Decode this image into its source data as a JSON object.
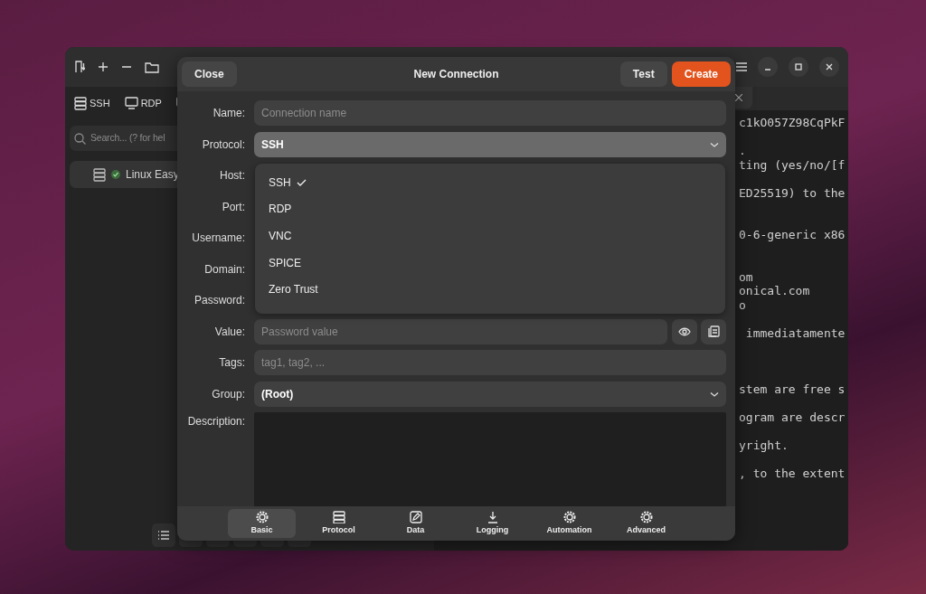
{
  "sidebar": {
    "protocol_filters": [
      {
        "label": "SSH"
      },
      {
        "label": "RDP"
      }
    ],
    "search": {
      "placeholder": "Search... (? for hel"
    },
    "items": [
      {
        "label": "Linux Easy",
        "connected": true,
        "selected": true
      }
    ]
  },
  "terminal": {
    "lines": [
      {
        "kind": "text",
        "text": "c1kO057Z98CqPkF"
      },
      {
        "kind": "blank"
      },
      {
        "kind": "text",
        "text": "."
      },
      {
        "kind": "text",
        "text": "ting (yes/no/[f"
      },
      {
        "kind": "blank"
      },
      {
        "kind": "text",
        "text": "ED25519) to the"
      },
      {
        "kind": "blank"
      },
      {
        "kind": "blank"
      },
      {
        "kind": "text",
        "text": "0-6-generic x86"
      },
      {
        "kind": "blank"
      },
      {
        "kind": "blank"
      },
      {
        "kind": "text",
        "text": "om"
      },
      {
        "kind": "text",
        "text": "onical.com"
      },
      {
        "kind": "text",
        "text": "o"
      },
      {
        "kind": "blank"
      },
      {
        "kind": "text",
        "text": " immediatamente"
      },
      {
        "kind": "blank"
      },
      {
        "kind": "blank"
      },
      {
        "kind": "blank"
      },
      {
        "kind": "text",
        "text": "stem are free s"
      },
      {
        "kind": "blank"
      },
      {
        "kind": "text",
        "text": "ogram are descr"
      },
      {
        "kind": "blank"
      },
      {
        "kind": "text",
        "text": "yright."
      },
      {
        "kind": "blank"
      },
      {
        "kind": "text",
        "text": ", to the extent"
      }
    ]
  },
  "dialog": {
    "title": "New Connection",
    "buttons": [
      {
        "label": "Close",
        "kind": "plain"
      },
      {
        "label": "Test",
        "kind": "plain"
      },
      {
        "label": "Create",
        "kind": "primary"
      }
    ],
    "fields": [
      {
        "label": "Name:",
        "kind": "text",
        "placeholder": "Connection name"
      },
      {
        "label": "Protocol:",
        "kind": "select",
        "value": "SSH",
        "expanded": true
      },
      {
        "label": "Host:",
        "kind": "covered"
      },
      {
        "label": "Port:",
        "kind": "covered"
      },
      {
        "label": "Username:",
        "kind": "covered"
      },
      {
        "label": "Domain:",
        "kind": "covered"
      },
      {
        "label": "Password:",
        "kind": "covered"
      },
      {
        "label": "Value:",
        "kind": "secret",
        "placeholder": "Password value"
      },
      {
        "label": "Tags:",
        "kind": "text",
        "placeholder": "tag1, tag2, ..."
      },
      {
        "label": "Group:",
        "kind": "select",
        "value": "(Root)",
        "expanded": false
      },
      {
        "label": "Description:",
        "kind": "textarea"
      }
    ],
    "protocol_options": [
      {
        "label": "SSH",
        "selected": true
      },
      {
        "label": "RDP",
        "selected": false
      },
      {
        "label": "VNC",
        "selected": false
      },
      {
        "label": "SPICE",
        "selected": false
      },
      {
        "label": "Zero Trust",
        "selected": false
      }
    ],
    "tabs": [
      {
        "label": "Basic",
        "selected": true
      },
      {
        "label": "Protocol",
        "selected": false
      },
      {
        "label": "Data",
        "selected": false
      },
      {
        "label": "Logging",
        "selected": false
      },
      {
        "label": "Automation",
        "selected": false
      },
      {
        "label": "Advanced",
        "selected": false
      }
    ]
  }
}
